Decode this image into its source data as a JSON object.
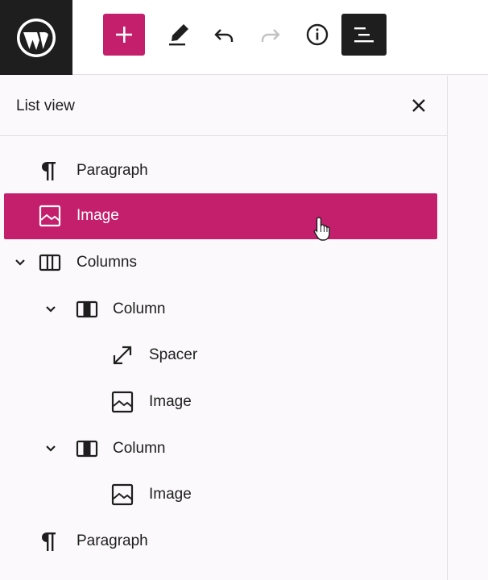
{
  "toolbar": {
    "logo_icon": "wordpress-logo-icon",
    "add_icon": "plus-icon",
    "tools_icon": "pencil-icon",
    "undo_icon": "undo-icon",
    "redo_icon": "redo-icon",
    "info_icon": "info-icon",
    "list_view_icon": "list-view-icon",
    "accent_color": "#c41f6c"
  },
  "panel": {
    "title": "List view",
    "close_icon": "close-icon",
    "selected_color": "#c41f6c"
  },
  "tree": [
    {
      "label": "Paragraph",
      "icon": "paragraph-icon",
      "depth": 1,
      "expandable": false,
      "selected": false
    },
    {
      "label": "Image",
      "icon": "image-icon",
      "depth": 1,
      "expandable": false,
      "selected": true
    },
    {
      "label": "Columns",
      "icon": "columns-icon",
      "depth": 1,
      "expandable": true,
      "selected": false
    },
    {
      "label": "Column",
      "icon": "column-icon",
      "depth": 2,
      "expandable": true,
      "selected": false
    },
    {
      "label": "Spacer",
      "icon": "spacer-icon",
      "depth": 3,
      "expandable": false,
      "selected": false
    },
    {
      "label": "Image",
      "icon": "image-icon",
      "depth": 3,
      "expandable": false,
      "selected": false
    },
    {
      "label": "Column",
      "icon": "column-icon",
      "depth": 2,
      "expandable": true,
      "selected": false
    },
    {
      "label": "Image",
      "icon": "image-icon",
      "depth": 3,
      "expandable": false,
      "selected": false
    },
    {
      "label": "Paragraph",
      "icon": "paragraph-icon",
      "depth": 1,
      "expandable": false,
      "selected": false
    }
  ]
}
